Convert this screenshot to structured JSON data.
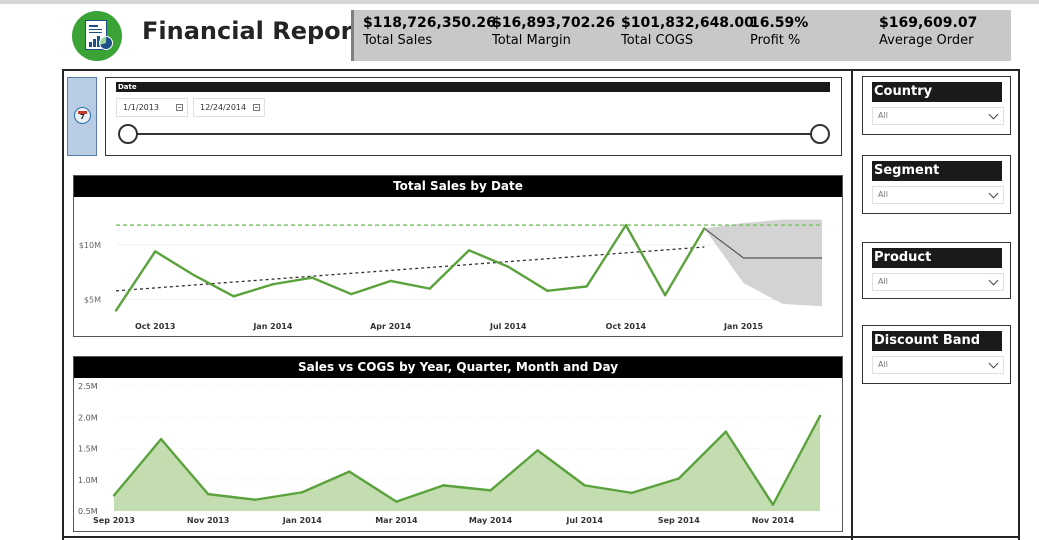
{
  "header": {
    "title": "Financial Report",
    "logo_icon": "financial-report-icon"
  },
  "kpis": [
    {
      "value": "$118,726,350.26",
      "label": "Total Sales"
    },
    {
      "value": "$16,893,702.26",
      "label": "Total Margin"
    },
    {
      "value": "$101,832,648.00",
      "label": "Total COGS"
    },
    {
      "value": "16.59%",
      "label": "Profit %"
    },
    {
      "value": "$169,609.07",
      "label": "Average Order"
    }
  ],
  "date_filter": {
    "title": "Date",
    "start": "1/1/2013",
    "end": "12/24/2014",
    "calendar_icon": "calendar-icon",
    "calendar_icon_text": "7"
  },
  "slicers": [
    {
      "title": "Country",
      "value": "All"
    },
    {
      "title": "Segment",
      "value": "All"
    },
    {
      "title": "Product",
      "value": "All"
    },
    {
      "title": "Discount Band",
      "value": "All"
    }
  ],
  "colors": {
    "accent_green": "#5aa23c",
    "area_fill": "#c3ddb1",
    "title_bar": "#000000",
    "kpi_bg": "#c8c8c8",
    "forecast_band": "#d3d3d3"
  },
  "chart_data": [
    {
      "type": "line",
      "title": "Total Sales by Date",
      "x": [
        "2013-09",
        "2013-10",
        "2013-11",
        "2013-12",
        "2014-01",
        "2014-02",
        "2014-03",
        "2014-04",
        "2014-05",
        "2014-06",
        "2014-07",
        "2014-08",
        "2014-09",
        "2014-10",
        "2014-11",
        "2014-12"
      ],
      "xtick_labels": [
        "Oct 2013",
        "Jan 2014",
        "Apr 2014",
        "Jul 2014",
        "Oct 2014",
        "Jan 2015"
      ],
      "ytick_labels": [
        "$10M",
        "$5M"
      ],
      "ylim": [
        3.5,
        13
      ],
      "series": [
        {
          "values": [
            4.0,
            9.4,
            7.2,
            5.3,
            6.4,
            7.0,
            5.5,
            6.7,
            6.0,
            9.5,
            8.0,
            5.8,
            6.2,
            11.8,
            5.4,
            11.5
          ]
        }
      ],
      "trend_line": [
        5.8,
        9.8
      ],
      "reference_line": 11.8,
      "forecast": {
        "x": [
          "2014-12",
          "2015-01",
          "2015-02",
          "2015-03"
        ],
        "values": [
          11.5,
          8.8,
          8.8,
          8.8
        ],
        "upper": [
          11.5,
          12.0,
          12.3,
          12.3
        ],
        "lower": [
          11.5,
          6.5,
          4.6,
          4.4
        ]
      }
    },
    {
      "type": "area",
      "title": "Sales vs COGS by Year, Quarter, Month and Day",
      "x": [
        "2013-09",
        "2013-10",
        "2013-11",
        "2013-12",
        "2014-01",
        "2014-02",
        "2014-03",
        "2014-04",
        "2014-05",
        "2014-06",
        "2014-07",
        "2014-08",
        "2014-09",
        "2014-10",
        "2014-11",
        "2014-12"
      ],
      "xtick_labels": [
        "Sep 2013",
        "Nov 2013",
        "Jan 2014",
        "Mar 2014",
        "May 2014",
        "Jul 2014",
        "Sep 2014",
        "Nov 2014"
      ],
      "ytick_labels": [
        "2.5M",
        "2.0M",
        "1.5M",
        "1.0M",
        "0.5M"
      ],
      "ylim": [
        0.5,
        2.5
      ],
      "series": [
        {
          "values": [
            0.75,
            1.65,
            0.77,
            0.68,
            0.8,
            1.13,
            0.65,
            0.91,
            0.83,
            1.47,
            0.91,
            0.79,
            1.02,
            1.77,
            0.6,
            2.02
          ]
        }
      ]
    }
  ]
}
